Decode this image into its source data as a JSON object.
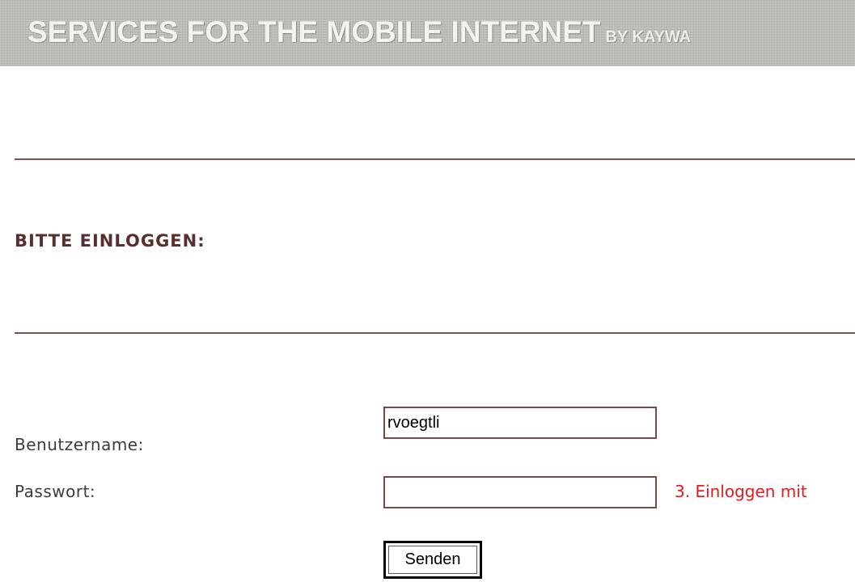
{
  "banner": {
    "title": "SERVICES FOR THE MOBILE INTERNET",
    "by_text": "BY KAYWA"
  },
  "login": {
    "heading": "BITTE EINLOGGEN:",
    "username_label": "Benutzername:",
    "username_value": "rvoegtli",
    "password_label": "Passwort:",
    "password_value": "",
    "hint": "3. Einloggen mit",
    "submit_label": "Senden"
  },
  "colors": {
    "banner_bg": "#bdbcb6",
    "rule": "#7a5151",
    "heading": "#5a2e2e",
    "hint": "#e8191b"
  }
}
